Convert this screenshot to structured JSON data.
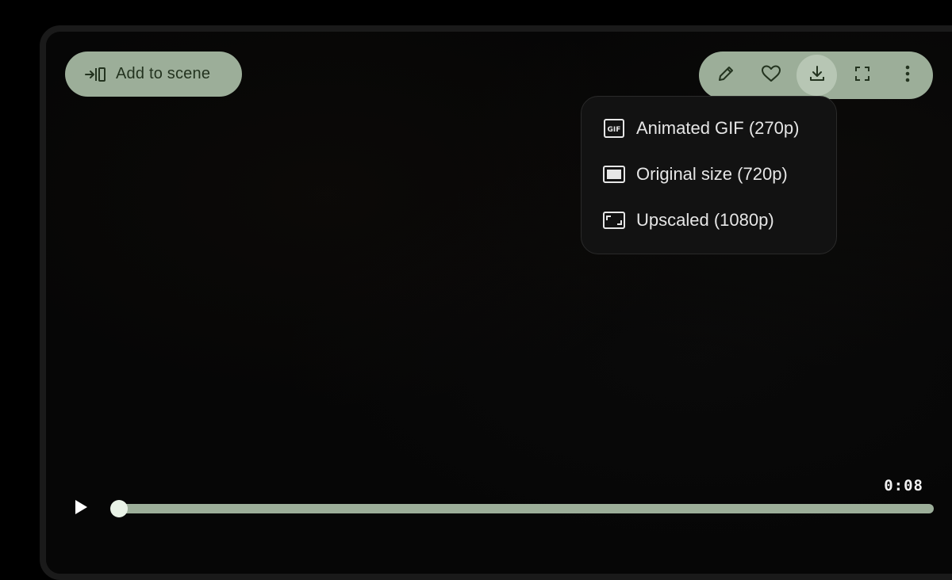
{
  "add_to_scene": {
    "label": "Add to scene",
    "icon": "add-to-scene-icon"
  },
  "toolbar": {
    "buttons": [
      {
        "icon": "pencil-icon",
        "label": "Edit"
      },
      {
        "icon": "heart-icon",
        "label": "Favorite"
      },
      {
        "icon": "download-icon",
        "label": "Download",
        "active": true
      },
      {
        "icon": "fullscreen-icon",
        "label": "Fullscreen"
      },
      {
        "icon": "more-vert-icon",
        "label": "More options"
      }
    ]
  },
  "download_menu": {
    "items": [
      {
        "label": "Animated GIF (270p)",
        "icon": "gif-icon"
      },
      {
        "label": "Original size (720p)",
        "icon": "original-size-icon"
      },
      {
        "label": "Upscaled (1080p)",
        "icon": "upscale-icon"
      }
    ]
  },
  "player": {
    "time": "0:08",
    "progress": 0.0
  },
  "colors": {
    "accent": "#9cae99",
    "accent_text": "#23331f",
    "menu_bg": "#121212",
    "thumb": "#e8f2e6"
  }
}
